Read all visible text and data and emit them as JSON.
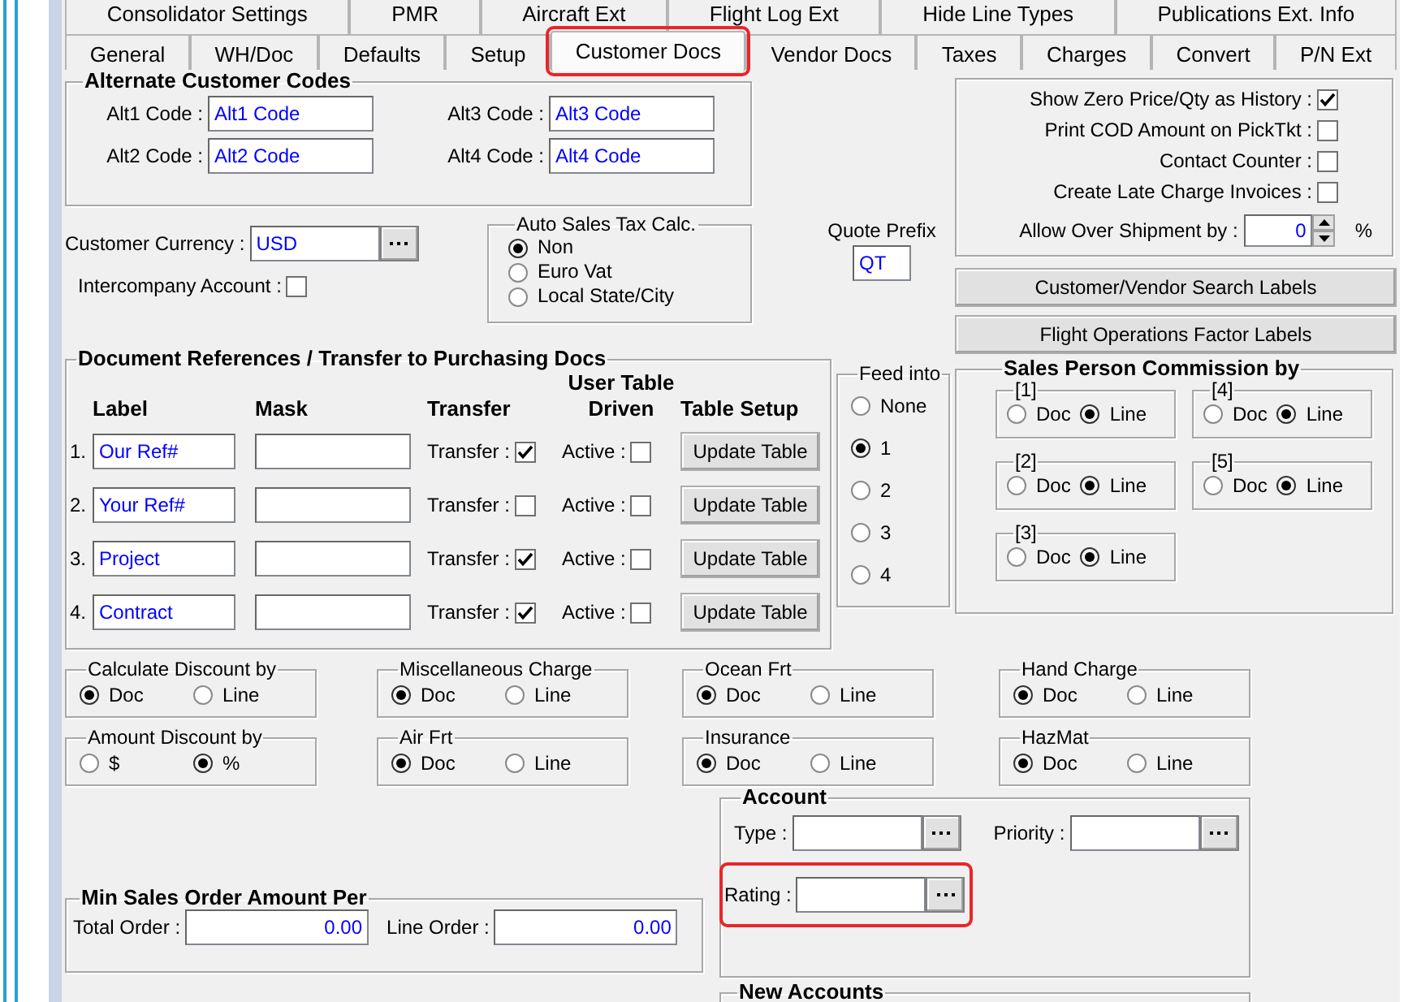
{
  "tab_rows": [
    {
      "tabs": [
        {
          "label": "Consolidator Settings",
          "selected": false,
          "highlighted": false
        },
        {
          "label": "PMR",
          "selected": false,
          "highlighted": false
        },
        {
          "label": "Aircraft Ext",
          "selected": false,
          "highlighted": false
        },
        {
          "label": "Flight Log Ext",
          "selected": false,
          "highlighted": false
        },
        {
          "label": "Hide Line Types",
          "selected": false,
          "highlighted": false
        },
        {
          "label": "Publications Ext. Info",
          "selected": false,
          "highlighted": false
        }
      ]
    },
    {
      "tabs": [
        {
          "label": "General",
          "selected": false,
          "highlighted": false
        },
        {
          "label": "WH/Doc",
          "selected": false,
          "highlighted": false
        },
        {
          "label": "Defaults",
          "selected": false,
          "highlighted": false
        },
        {
          "label": "Setup",
          "selected": false,
          "highlighted": false
        },
        {
          "label": "Customer Docs",
          "selected": true,
          "highlighted": true
        },
        {
          "label": "Vendor Docs",
          "selected": false,
          "highlighted": false
        },
        {
          "label": "Taxes",
          "selected": false,
          "highlighted": false
        },
        {
          "label": "Charges",
          "selected": false,
          "highlighted": false
        },
        {
          "label": "Convert",
          "selected": false,
          "highlighted": false
        },
        {
          "label": "P/N Ext",
          "selected": false,
          "highlighted": false
        }
      ]
    }
  ],
  "alternate_codes": {
    "title": "Alternate Customer Codes",
    "fields": [
      {
        "label": "Alt1 Code :",
        "value": "Alt1 Code"
      },
      {
        "label": "Alt3 Code :",
        "value": "Alt3 Code"
      },
      {
        "label": "Alt2 Code :",
        "value": "Alt2 Code"
      },
      {
        "label": "Alt4 Code :",
        "value": "Alt4 Code"
      }
    ]
  },
  "customer_currency": {
    "label": "Customer Currency :",
    "value": "USD"
  },
  "intercompany_account": {
    "label": "Intercompany Account :",
    "checked": false
  },
  "auto_sales_tax": {
    "title": "Auto Sales Tax Calc.",
    "options": [
      {
        "label": "Non",
        "selected": true
      },
      {
        "label": "Euro Vat",
        "selected": false
      },
      {
        "label": "Local State/City",
        "selected": false
      }
    ]
  },
  "quote_prefix": {
    "label": "Quote Prefix",
    "value": "QT"
  },
  "options": {
    "checkboxes": [
      {
        "label": "Show Zero Price/Qty as History :",
        "checked": true
      },
      {
        "label": "Print COD Amount on PickTkt :",
        "checked": false
      },
      {
        "label": "Contact Counter :",
        "checked": false
      },
      {
        "label": "Create Late Charge Invoices :",
        "checked": false
      }
    ],
    "over_shipment": {
      "label": "Allow Over Shipment by :",
      "value": "0",
      "unit": "%"
    }
  },
  "buttons": [
    "Customer/Vendor Search Labels",
    "Flight Operations Factor Labels"
  ],
  "document_references": {
    "title": "Document References / Transfer to Purchasing Docs",
    "columns": [
      "Label",
      "Mask",
      "Transfer",
      "User Table Driven",
      "Table Setup"
    ],
    "rows": [
      {
        "number": "1.",
        "label": "Our Ref#",
        "transfer_label": "Transfer :",
        "transfer": true,
        "active_label": "Active :",
        "active": false,
        "button": "Update Table"
      },
      {
        "number": "2.",
        "label": "Your Ref#",
        "transfer_label": "Transfer :",
        "transfer": false,
        "active_label": "Active :",
        "active": false,
        "button": "Update Table"
      },
      {
        "number": "3.",
        "label": "Project",
        "transfer_label": "Transfer :",
        "transfer": true,
        "active_label": "Active :",
        "active": false,
        "button": "Update Table"
      },
      {
        "number": "4.",
        "label": "Contract",
        "transfer_label": "Transfer :",
        "transfer": true,
        "active_label": "Active :",
        "active": false,
        "button": "Update Table"
      }
    ]
  },
  "feed_into": {
    "title": "Feed into",
    "options": [
      {
        "label": "None",
        "selected": false
      },
      {
        "label": "1",
        "selected": true
      },
      {
        "label": "2",
        "selected": false
      },
      {
        "label": "3",
        "selected": false
      },
      {
        "label": "4",
        "selected": false
      }
    ]
  },
  "sales_person_commission": {
    "title": "Sales Person Commission by",
    "groups": [
      {
        "title": "[1]",
        "options": [
          {
            "label": "Doc",
            "selected": false
          },
          {
            "label": "Line",
            "selected": true
          }
        ]
      },
      {
        "title": "[4]",
        "options": [
          {
            "label": "Doc",
            "selected": false
          },
          {
            "label": "Line",
            "selected": true
          }
        ]
      },
      {
        "title": "[2]",
        "options": [
          {
            "label": "Doc",
            "selected": false
          },
          {
            "label": "Line",
            "selected": true
          }
        ]
      },
      {
        "title": "[5]",
        "options": [
          {
            "label": "Doc",
            "selected": false
          },
          {
            "label": "Line",
            "selected": true
          }
        ]
      },
      {
        "title": "[3]",
        "options": [
          {
            "label": "Doc",
            "selected": false
          },
          {
            "label": "Line",
            "selected": true
          }
        ]
      }
    ]
  },
  "radio_groups": [
    {
      "title": "Calculate Discount by",
      "options": [
        {
          "label": "Doc",
          "selected": true
        },
        {
          "label": "Line",
          "selected": false
        }
      ]
    },
    {
      "title": "Miscellaneous Charge",
      "options": [
        {
          "label": "Doc",
          "selected": true
        },
        {
          "label": "Line",
          "selected": false
        }
      ]
    },
    {
      "title": "Ocean Frt",
      "options": [
        {
          "label": "Doc",
          "selected": true
        },
        {
          "label": "Line",
          "selected": false
        }
      ]
    },
    {
      "title": "Hand Charge",
      "options": [
        {
          "label": "Doc",
          "selected": true
        },
        {
          "label": "Line",
          "selected": false
        }
      ]
    },
    {
      "title": "Amount Discount by",
      "options": [
        {
          "label": "$",
          "selected": false
        },
        {
          "label": "%",
          "selected": true
        }
      ]
    },
    {
      "title": "Air Frt",
      "options": [
        {
          "label": "Doc",
          "selected": true
        },
        {
          "label": "Line",
          "selected": false
        }
      ]
    },
    {
      "title": "Insurance",
      "options": [
        {
          "label": "Doc",
          "selected": true
        },
        {
          "label": "Line",
          "selected": false
        }
      ]
    },
    {
      "title": "HazMat",
      "options": [
        {
          "label": "Doc",
          "selected": true
        },
        {
          "label": "Line",
          "selected": false
        }
      ]
    }
  ],
  "min_sales_order": {
    "title": "Min Sales Order Amount Per",
    "fields": [
      {
        "label": "Total Order :",
        "value": "0.00"
      },
      {
        "label": "Line Order :",
        "value": "0.00"
      }
    ]
  },
  "account": {
    "title": "Account",
    "fields": [
      {
        "label": "Type :",
        "highlighted": false
      },
      {
        "label": "Priority :",
        "highlighted": false
      },
      {
        "label": "Rating :",
        "highlighted": true
      }
    ]
  },
  "new_accounts": {
    "title": "New Accounts"
  }
}
